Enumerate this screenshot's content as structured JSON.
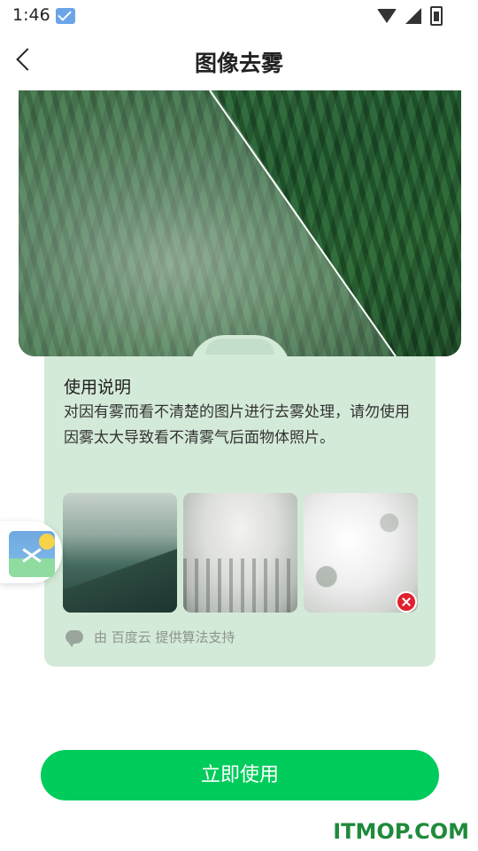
{
  "status_bar": {
    "time": "1:46"
  },
  "header": {
    "title": "图像去雾"
  },
  "instructions": {
    "heading": "使用说明",
    "description": "对因有雾而看不清楚的图片进行去雾处理，请勿使用因雾太大导致看不清雾气后面物体照片。"
  },
  "credit": {
    "text": "由 百度云 提供算法支持"
  },
  "action": {
    "use_label": "立即使用"
  },
  "watermark": "ITMOP.COM",
  "colors": {
    "accent": "#00cc5c",
    "card_bg": "#d4ead8",
    "reject": "#e0202e"
  },
  "icons": [
    "mail-icon",
    "wifi-icon",
    "signal-icon",
    "battery-icon",
    "back-icon",
    "chat-icon",
    "gallery-icon",
    "reject-icon"
  ]
}
